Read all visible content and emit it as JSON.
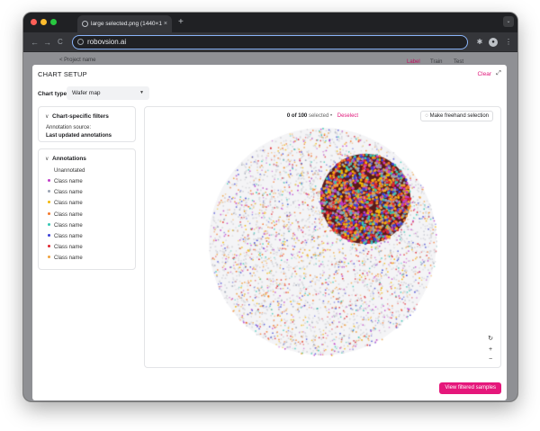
{
  "browser": {
    "tab_title": "large selected.png (1440×1",
    "tab_close": "×",
    "new_tab": "+",
    "address": "robovsion.ai",
    "back": "←",
    "forward": "→",
    "reload": "C",
    "tab_menu": "⌄",
    "menu": "⋮"
  },
  "background_page": {
    "project_name": "< Project name",
    "tab1": "Label",
    "tab2": "Train",
    "tab3": "Test"
  },
  "modal": {
    "title": "CHART SETUP",
    "clear_label": "Clear",
    "chart_type_label": "Chart type",
    "chart_type_value": "Wafer map",
    "filters": {
      "heading": "Chart-specific filters",
      "source_label": "Annotation source:",
      "source_value": "Last updated annotations"
    },
    "annotations": {
      "heading": "Annotations",
      "unannotated": "Unannotated",
      "items": [
        {
          "label": "Class name",
          "color": "#c13cc8"
        },
        {
          "label": "Class name",
          "color": "#9aa3b2"
        },
        {
          "label": "Class name",
          "color": "#f2b705"
        },
        {
          "label": "Class name",
          "color": "#f5782a"
        },
        {
          "label": "Class name",
          "color": "#33c6b4"
        },
        {
          "label": "Class name",
          "color": "#3a3fd6"
        },
        {
          "label": "Class name",
          "color": "#e0242d"
        },
        {
          "label": "Class name",
          "color": "#f0a13c"
        }
      ]
    },
    "chart": {
      "selected_count": "0 of 100",
      "selected_suffix": "selected •",
      "deselect_label": "Deselect",
      "freehand_label": "Make freehand selection",
      "reset_icon": "↻",
      "zoom_in": "+",
      "zoom_out": "−"
    },
    "view_button": "View filtered samples",
    "accent_color": "#e5177b"
  }
}
